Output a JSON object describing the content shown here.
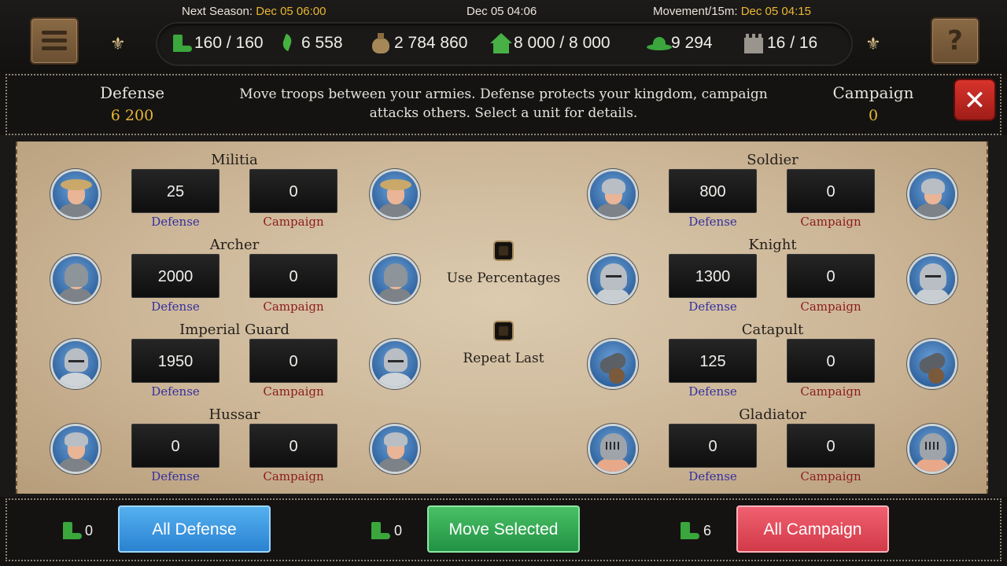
{
  "header": {
    "next_season_label": "Next Season:",
    "next_season_time": "Dec 05 06:00",
    "current_time": "Dec 05 04:06",
    "movement_label": "Movement/15m:",
    "movement_time": "Dec 05 04:15",
    "help_label": "?"
  },
  "resources": [
    {
      "icon": "boot-icon",
      "value": "160 / 160"
    },
    {
      "icon": "leaf-icon",
      "value": "6 558"
    },
    {
      "icon": "money-bag-icon",
      "value": "2 784 860"
    },
    {
      "icon": "house-icon",
      "value": "8 000 / 8 000"
    },
    {
      "icon": "hat-icon",
      "value": "9 294"
    },
    {
      "icon": "castle-icon",
      "value": "16 / 16"
    }
  ],
  "summary": {
    "defense_title": "Defense",
    "defense_value": "6 200",
    "description_line1": "Move troops between your armies. Defense protects your kingdom, campaign",
    "description_line2": "attacks others. Select a unit for details.",
    "campaign_title": "Campaign",
    "campaign_value": "0",
    "close_label": "✕"
  },
  "units": [
    {
      "name": "Militia",
      "defense": "25",
      "campaign": "0",
      "def_label": "Defense",
      "camp_label": "Campaign"
    },
    {
      "name": "Archer",
      "defense": "2000",
      "campaign": "0",
      "def_label": "Defense",
      "camp_label": "Campaign"
    },
    {
      "name": "Imperial Guard",
      "defense": "1950",
      "campaign": "0",
      "def_label": "Defense",
      "camp_label": "Campaign"
    },
    {
      "name": "Hussar",
      "defense": "0",
      "campaign": "0",
      "def_label": "Defense",
      "camp_label": "Campaign"
    },
    {
      "name": "Soldier",
      "defense": "800",
      "campaign": "0",
      "def_label": "Defense",
      "camp_label": "Campaign"
    },
    {
      "name": "Knight",
      "defense": "1300",
      "campaign": "0",
      "def_label": "Defense",
      "camp_label": "Campaign"
    },
    {
      "name": "Catapult",
      "defense": "125",
      "campaign": "0",
      "def_label": "Defense",
      "camp_label": "Campaign"
    },
    {
      "name": "Gladiator",
      "defense": "0",
      "campaign": "0",
      "def_label": "Defense",
      "camp_label": "Campaign"
    }
  ],
  "options": {
    "use_percentages": "Use Percentages",
    "repeat_last": "Repeat Last"
  },
  "footer": {
    "defense_count": "0",
    "all_defense": "All Defense",
    "selected_count": "0",
    "move_selected": "Move Selected",
    "campaign_count": "6",
    "all_campaign": "All Campaign"
  }
}
